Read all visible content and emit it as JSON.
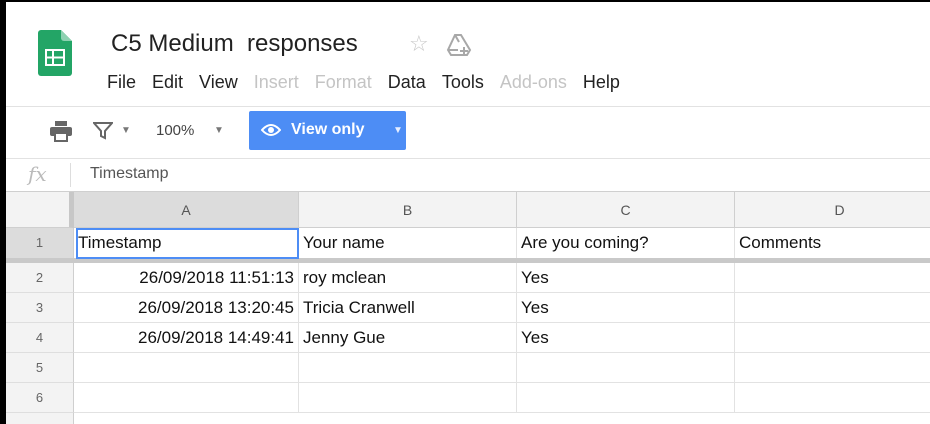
{
  "app": {
    "title": "C5 Medium  responses",
    "star_icon": "star-outline-icon",
    "drive_icon": "drive-move-icon",
    "brand_color": "#23a566"
  },
  "menu": [
    {
      "label": "File",
      "enabled": true
    },
    {
      "label": "Edit",
      "enabled": true
    },
    {
      "label": "View",
      "enabled": true
    },
    {
      "label": "Insert",
      "enabled": false
    },
    {
      "label": "Format",
      "enabled": false
    },
    {
      "label": "Data",
      "enabled": true
    },
    {
      "label": "Tools",
      "enabled": true
    },
    {
      "label": "Add-ons",
      "enabled": false
    },
    {
      "label": "Help",
      "enabled": true
    }
  ],
  "toolbar": {
    "zoom": "100%",
    "view_only_label": "View only",
    "accent": "#4d8df5"
  },
  "formula_bar": {
    "fx": "fx",
    "value": "Timestamp"
  },
  "grid": {
    "columns": [
      "A",
      "B",
      "C",
      "D"
    ],
    "row_numbers": [
      "1",
      "2",
      "3",
      "4",
      "5",
      "6"
    ],
    "header_row": [
      "Timestamp",
      "Your name",
      "Are you coming?",
      "Comments"
    ],
    "rows": [
      [
        "26/09/2018 11:51:13",
        "roy mclean",
        "Yes",
        ""
      ],
      [
        "26/09/2018 13:20:45",
        "Tricia Cranwell",
        "Yes",
        ""
      ],
      [
        "26/09/2018 14:49:41",
        "Jenny Gue",
        "Yes",
        ""
      ],
      [
        "",
        "",
        "",
        ""
      ],
      [
        "",
        "",
        "",
        ""
      ]
    ],
    "selected_cell": "A1"
  }
}
